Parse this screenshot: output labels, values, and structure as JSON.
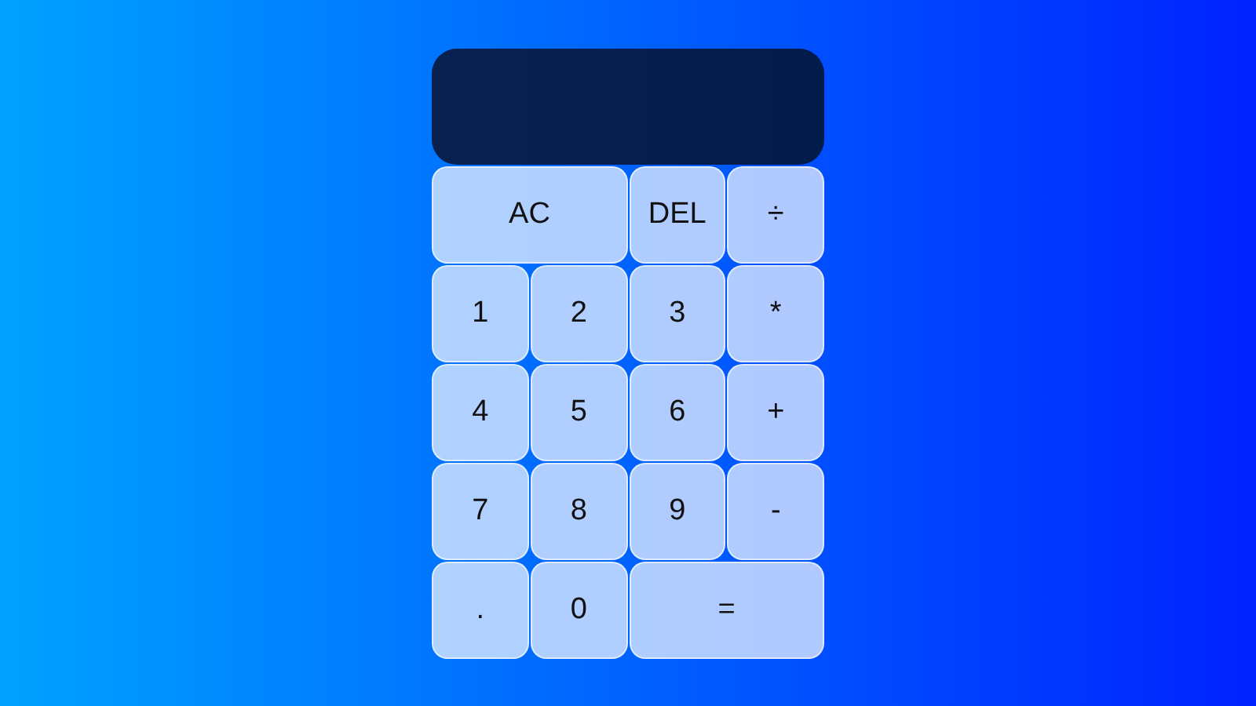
{
  "keys": [
    {
      "label": "AC",
      "wide": true
    },
    {
      "label": "DEL",
      "wide": false
    },
    {
      "label": "÷",
      "wide": false
    },
    {
      "label": "1",
      "wide": false
    },
    {
      "label": "2",
      "wide": false
    },
    {
      "label": "3",
      "wide": false
    },
    {
      "label": "*",
      "wide": false
    },
    {
      "label": "4",
      "wide": false
    },
    {
      "label": "5",
      "wide": false
    },
    {
      "label": "6",
      "wide": false
    },
    {
      "label": "+",
      "wide": false
    },
    {
      "label": "7",
      "wide": false
    },
    {
      "label": "8",
      "wide": false
    },
    {
      "label": "9",
      "wide": false
    },
    {
      "label": "-",
      "wide": false
    },
    {
      "label": ".",
      "wide": false
    },
    {
      "label": "0",
      "wide": false
    },
    {
      "label": "=",
      "wide": true
    }
  ]
}
